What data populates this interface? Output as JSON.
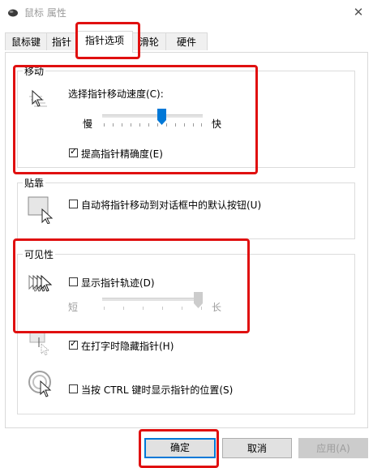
{
  "window": {
    "title": "鼠标 属性",
    "close_glyph": "✕"
  },
  "tabs": [
    {
      "label": "鼠标键"
    },
    {
      "label": "指针"
    },
    {
      "label": "指针选项"
    },
    {
      "label": "滑轮"
    },
    {
      "label": "硬件"
    }
  ],
  "motion": {
    "group_title": "移动",
    "speed_label": "选择指针移动速度(C):",
    "slow_label": "慢",
    "fast_label": "快",
    "speed_level": 0.6,
    "precision_label": "提高指针精确度(E)",
    "precision_checked": true
  },
  "snap": {
    "group_title": "贴靠",
    "snapto_label": "自动将指针移动到对话框中的默认按钮(U)",
    "snapto_checked": false
  },
  "visibility": {
    "group_title": "可见性",
    "trails_label": "显示指针轨迹(D)",
    "trails_checked": false,
    "short_label": "短",
    "long_label": "长",
    "trails_level": 1.0,
    "hide_typing_label": "在打字时隐藏指针(H)",
    "hide_typing_checked": true,
    "ctrl_label": "当按 CTRL 键时显示指针的位置(S)",
    "ctrl_checked": false
  },
  "buttons": {
    "ok_label": "确定",
    "cancel_label": "取消",
    "apply_label": "应用(A)"
  },
  "colors": {
    "accent": "#0078d7",
    "highlight_box": "#e01010"
  }
}
